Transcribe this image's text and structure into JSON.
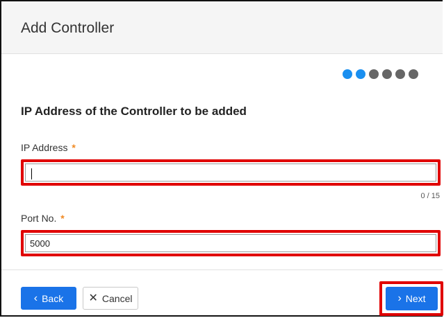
{
  "dialog": {
    "title": "Add Controller"
  },
  "steps": {
    "total": 6,
    "active": 2,
    "active_color": "#1a8ff0",
    "inactive_color": "#666666"
  },
  "section": {
    "title": "IP Address of the Controller to be added"
  },
  "ip_field": {
    "label": "IP Address",
    "required_mark": "*",
    "value": "",
    "counter": "0 / 15"
  },
  "port_field": {
    "label": "Port No.",
    "required_mark": "*",
    "value": "5000"
  },
  "footer": {
    "back_label": "Back",
    "back_icon": "chevron-left-icon",
    "cancel_label": "Cancel",
    "cancel_icon": "close-icon",
    "next_label": "Next",
    "next_icon": "chevron-right-icon"
  },
  "colors": {
    "highlight": "#e00000",
    "primary": "#1a73e8",
    "required": "#f08a24"
  }
}
